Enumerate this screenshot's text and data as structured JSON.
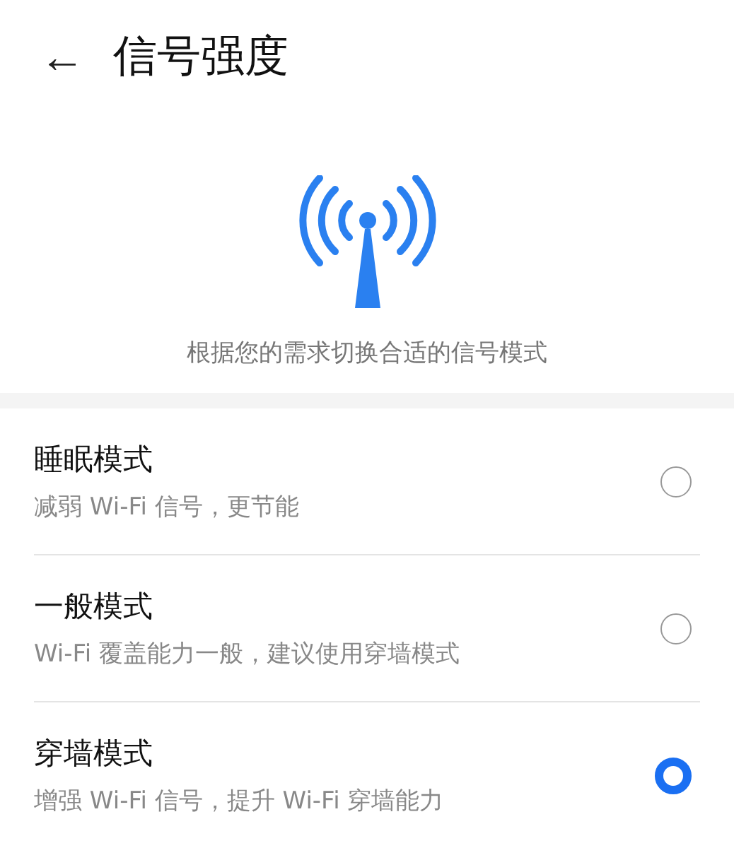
{
  "header": {
    "back": "←",
    "title": "信号强度"
  },
  "intro": {
    "caption": "根据您的需求切换合适的信号模式"
  },
  "modes": [
    {
      "title": "睡眠模式",
      "description": "减弱 Wi-Fi 信号，更节能",
      "selected": false
    },
    {
      "title": "一般模式",
      "description": "Wi-Fi 覆盖能力一般，建议使用穿墙模式",
      "selected": false
    },
    {
      "title": "穿墙模式",
      "description": "增强 Wi-Fi 信号，提升 Wi-Fi 穿墙能力",
      "selected": true
    }
  ]
}
